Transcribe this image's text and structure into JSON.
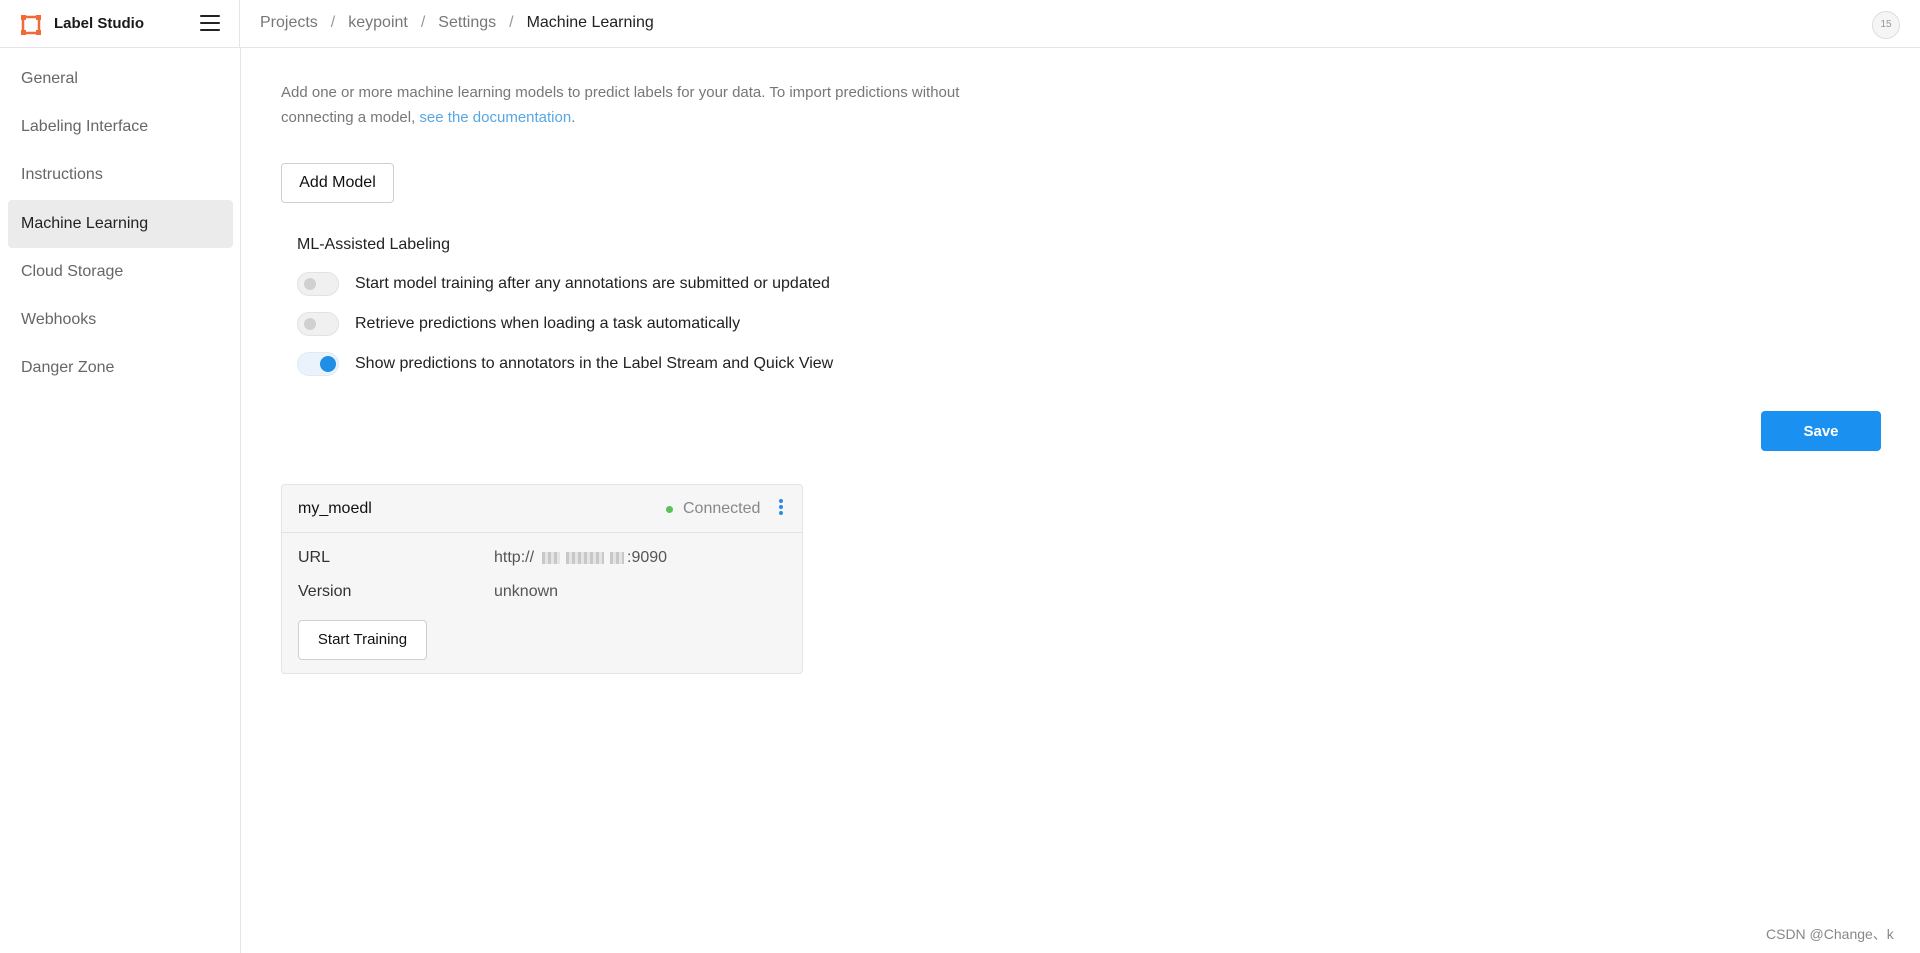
{
  "app": {
    "name": "Label Studio"
  },
  "breadcrumb": [
    "Projects",
    "keypoint",
    "Settings",
    "Machine Learning"
  ],
  "user": {
    "avatar_text": "15"
  },
  "sidebar": {
    "items": [
      {
        "label": "General"
      },
      {
        "label": "Labeling Interface"
      },
      {
        "label": "Instructions"
      },
      {
        "label": "Machine Learning",
        "active": true
      },
      {
        "label": "Cloud Storage"
      },
      {
        "label": "Webhooks"
      },
      {
        "label": "Danger Zone"
      }
    ]
  },
  "main": {
    "description_text": "Add one or more machine learning models to predict labels for your data. To import predictions without connecting a model, ",
    "description_link": "see the documentation",
    "description_end": ".",
    "add_model_label": "Add Model",
    "ml_assisted": {
      "heading": "ML-Assisted Labeling",
      "toggles": [
        {
          "label": "Start model training after any annotations are submitted or updated",
          "on": false
        },
        {
          "label": "Retrieve predictions when loading a task automatically",
          "on": false
        },
        {
          "label": "Show predictions to annotators in the Label Stream and Quick View",
          "on": true
        }
      ]
    },
    "save_label": "Save",
    "model_card": {
      "title": "my_moedl",
      "status": "Connected",
      "url_key": "URL",
      "url_prefix": "http://",
      "url_suffix": ":9090",
      "version_key": "Version",
      "version_value": "unknown",
      "start_training_label": "Start Training"
    }
  },
  "watermark": "CSDN @Change、k",
  "colors": {
    "primary": "#1a90f0",
    "link": "#57a7e3",
    "connected": "#5cc05c",
    "logo": "#f06b3a"
  }
}
